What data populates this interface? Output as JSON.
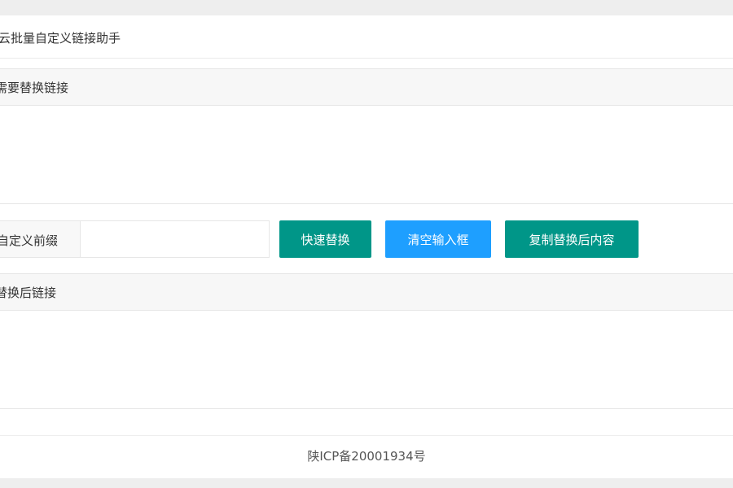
{
  "header": {
    "title": "云批量自定义链接助手"
  },
  "source": {
    "label": "需要替换链接",
    "value": ""
  },
  "toolbar": {
    "prefix_label": "自定义前缀",
    "prefix_value": "",
    "replace_label": "快速替换",
    "clear_label": "清空输入框",
    "copy_label": "复制替换后内容",
    "colors": {
      "green": "#009688",
      "blue": "#1E9FFF"
    }
  },
  "result": {
    "label": "替换后链接",
    "value": ""
  },
  "footer": {
    "icp": "陕ICP备20001934号"
  }
}
